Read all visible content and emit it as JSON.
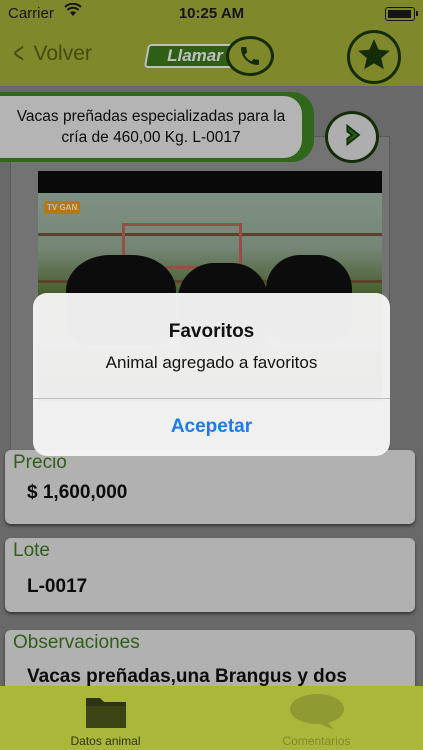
{
  "statusbar": {
    "carrier": "Carrier",
    "time": "10:25 AM"
  },
  "navbar": {
    "back_label": "Volver",
    "call_label": "Llamar"
  },
  "listing": {
    "title": "Vacas preñadas especializadas para la cría de 460,00 Kg. L-0017",
    "video_badge": "TV GAN"
  },
  "fields": {
    "precio": {
      "label": "Precio",
      "value": "$ 1,600,000"
    },
    "lote": {
      "label": "Lote",
      "value": "L-0017"
    },
    "observaciones": {
      "label": "Observaciones",
      "value": "Vacas preñadas,una Brangus y dos"
    }
  },
  "alert": {
    "title": "Favoritos",
    "message": "Animal agregado a favoritos",
    "button": "Acepetar"
  },
  "tabs": [
    {
      "label": "Datos animal",
      "icon": "folder-icon"
    },
    {
      "label": "Comentarios",
      "icon": "speech-bubble-icon"
    }
  ],
  "colors": {
    "bar_green": "#aab73a",
    "dark_green": "#1c3b0d",
    "label_green": "#3f7f22",
    "link_blue": "#1a7cf0"
  }
}
